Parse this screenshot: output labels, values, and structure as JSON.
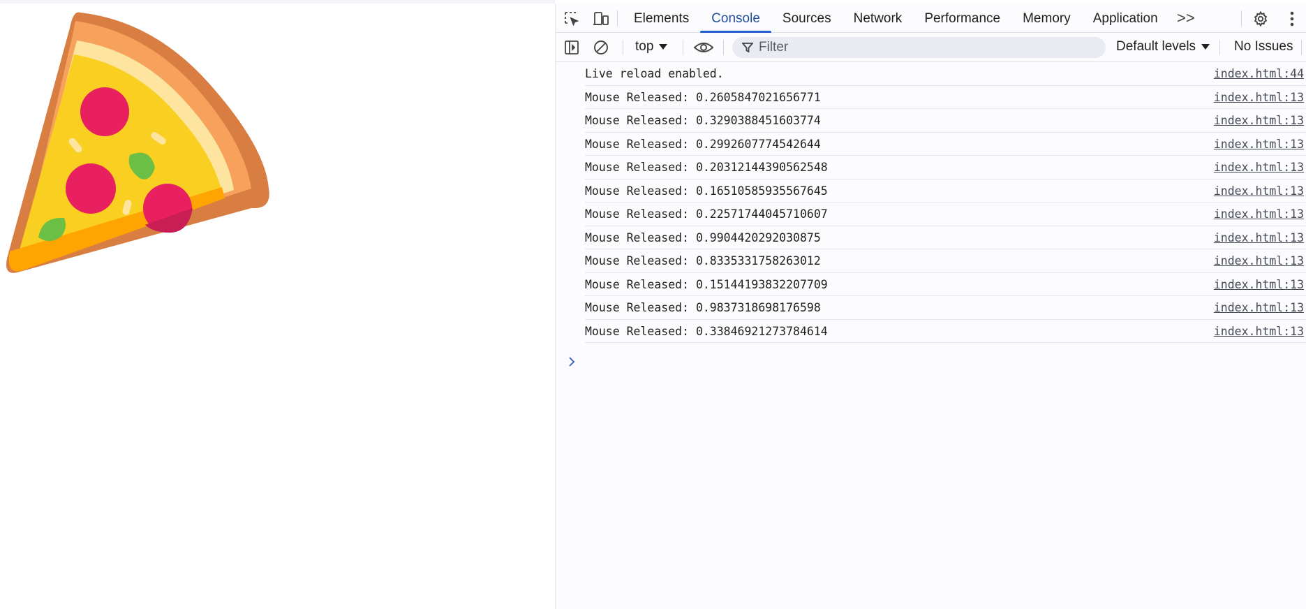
{
  "devtools": {
    "tabs": [
      {
        "label": "Elements",
        "active": false
      },
      {
        "label": "Console",
        "active": true
      },
      {
        "label": "Sources",
        "active": false
      },
      {
        "label": "Network",
        "active": false
      },
      {
        "label": "Performance",
        "active": false
      },
      {
        "label": "Memory",
        "active": false
      },
      {
        "label": "Application",
        "active": false
      }
    ],
    "more_tabs_label": ">>",
    "icons": {
      "inspect": "inspect-element-icon",
      "device": "device-toolbar-icon",
      "settings": "gear-icon",
      "menu": "kebab-menu-icon"
    },
    "accent_color": "#1f5fd1"
  },
  "toolbar": {
    "context": "top",
    "filter_placeholder": "Filter",
    "levels": "Default levels",
    "issues": "No Issues"
  },
  "console": {
    "messages": [
      {
        "text": "Live reload enabled.",
        "source": "index.html:44"
      },
      {
        "text": "Mouse Released: 0.2605847021656771",
        "source": "index.html:13"
      },
      {
        "text": "Mouse Released: 0.3290388451603774",
        "source": "index.html:13"
      },
      {
        "text": "Mouse Released: 0.2992607774542644",
        "source": "index.html:13"
      },
      {
        "text": "Mouse Released: 0.20312144390562548",
        "source": "index.html:13"
      },
      {
        "text": "Mouse Released: 0.16510585935567645",
        "source": "index.html:13"
      },
      {
        "text": "Mouse Released: 0.22571744045710607",
        "source": "index.html:13"
      },
      {
        "text": "Mouse Released: 0.9904420292030875",
        "source": "index.html:13"
      },
      {
        "text": "Mouse Released: 0.8335331758263012",
        "source": "index.html:13"
      },
      {
        "text": "Mouse Released: 0.15144193832207709",
        "source": "index.html:13"
      },
      {
        "text": "Mouse Released: 0.9837318698176598",
        "source": "index.html:13"
      },
      {
        "text": "Mouse Released: 0.33846921273784614",
        "source": "index.html:13"
      }
    ]
  },
  "page": {
    "image": "pizza-slice-icon"
  }
}
